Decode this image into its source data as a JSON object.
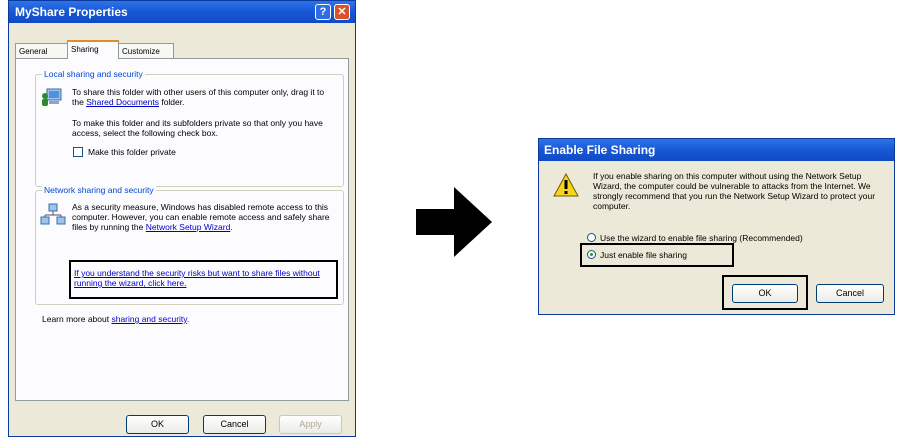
{
  "properties_dialog": {
    "title": "MyShare Properties",
    "help_glyph": "?",
    "close_glyph": "✕",
    "tabs": [
      "General",
      "Sharing",
      "Customize"
    ],
    "local": {
      "heading": "Local sharing and security",
      "para1": "To share this folder with other users of this computer only, drag it to the",
      "para1_link": "Shared Documents",
      "para1_end": " folder.",
      "para2": "To make this folder and its subfolders private so that only you have access, select the following check box.",
      "checkbox_label": "Make this folder private"
    },
    "network": {
      "heading": "Network sharing and security",
      "para": "As a security measure, Windows has disabled remote access to this computer. However, you can enable remote access and safely share files by running the",
      "wizard_link": "Network Setup Wizard",
      "para_end": ".",
      "risk_link": "If you understand the security risks but want to share files without running the wizard, click here."
    },
    "learn_more": "Learn more about ",
    "learn_more_link": "sharing and security",
    "learn_more_end": ".",
    "buttons": {
      "ok": "OK",
      "cancel": "Cancel",
      "apply": "Apply"
    }
  },
  "enable_dialog": {
    "title": "Enable File Sharing",
    "message": "If you enable sharing on this computer without using the Network Setup Wizard, the computer could be vulnerable to attacks from the Internet. We strongly recommend that you run the Network Setup Wizard to protect your computer.",
    "option_wizard": "Use the wizard to enable file sharing (Recommended)",
    "option_just": "Just enable file sharing",
    "selected": "Just enable file sharing",
    "buttons": {
      "ok": "OK",
      "cancel": "Cancel"
    }
  },
  "colors": {
    "title_bar": "#1757d6",
    "dialog_bg": "#ece9d8",
    "link": "#0000c8",
    "group_title": "#0046d5"
  },
  "icons": [
    "help-icon",
    "close-icon",
    "users-computer-icon",
    "network-icon",
    "warning-icon",
    "right-arrow-icon"
  ]
}
